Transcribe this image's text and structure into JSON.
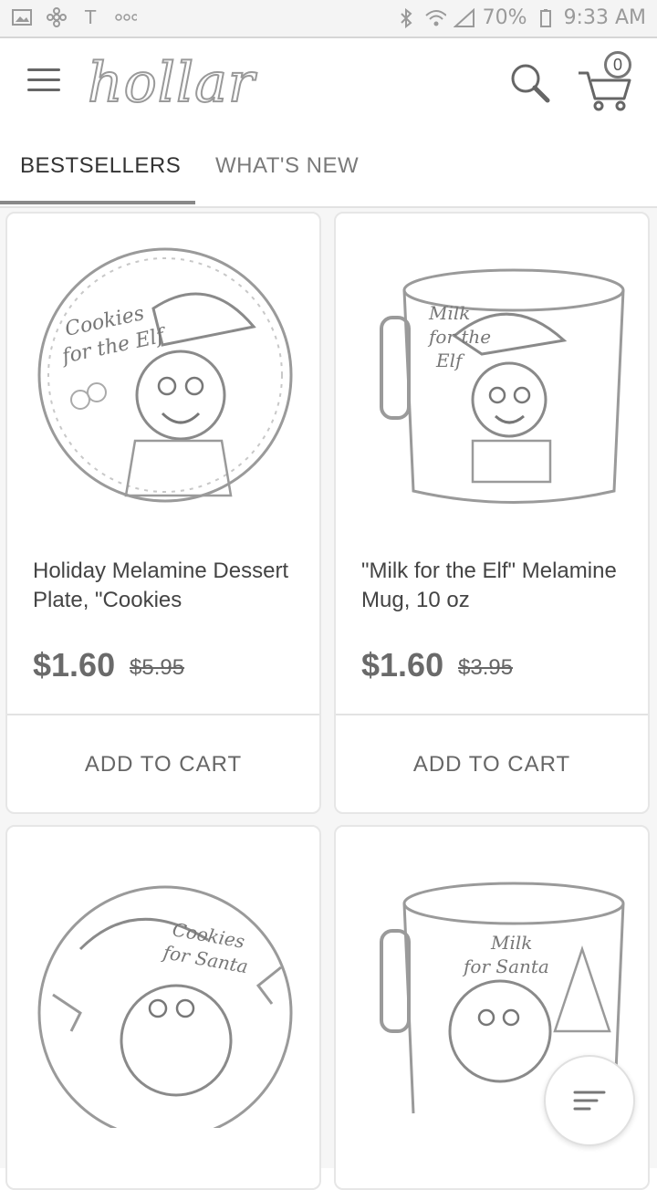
{
  "status_bar": {
    "battery_percent": "70%",
    "time": "9:33 AM",
    "left_icons": [
      "image-notification-icon",
      "pinwheel-icon",
      "tmobile-icon",
      "more-dots-icon"
    ],
    "right_icons": [
      "bluetooth-icon",
      "wifi-icon",
      "signal-icon",
      "battery-icon"
    ]
  },
  "app_bar": {
    "logo_text": "hollar",
    "cart_count": "0"
  },
  "tabs": [
    {
      "label": "BESTSELLERS",
      "active": true
    },
    {
      "label": "WHAT'S NEW",
      "active": false
    }
  ],
  "products": [
    {
      "title": "Holiday Melamine Dessert Plate, \"Cookies",
      "price": "$1.60",
      "old_price": "$5.95",
      "button_label": "ADD TO CART",
      "image_label": [
        "Cookies",
        "for the Elf"
      ]
    },
    {
      "title": "\"Milk for the Elf\" Melamine Mug, 10 oz",
      "price": "$1.60",
      "old_price": "$3.95",
      "button_label": "ADD TO CART",
      "image_label": [
        "Milk",
        "for the",
        "Elf"
      ]
    },
    {
      "image_label": [
        "Cookies",
        "for Santa"
      ]
    },
    {
      "image_label": [
        "Milk",
        "for Santa"
      ]
    }
  ],
  "colors": {
    "accent": "#888888",
    "background": "#ffffff",
    "text": "#444444"
  }
}
